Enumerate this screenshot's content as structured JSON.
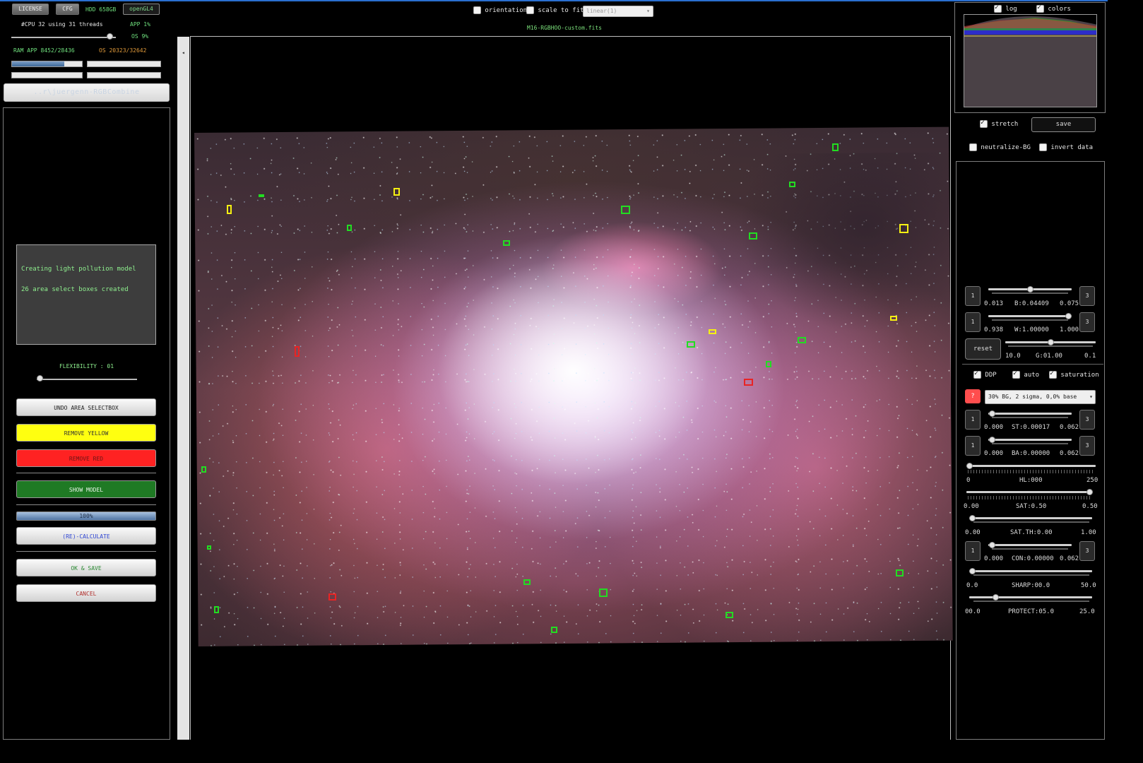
{
  "header": {
    "license": "LICENSE",
    "cfg": "CFG",
    "hdd": "HDD 658GB",
    "opengl": "openGL4",
    "cpu": "#CPU 32  using 31 threads",
    "app_cpu": "APP 1%",
    "os_cpu": "OS 9%",
    "ram": "RAM  APP 8452/28436",
    "ram_os": "OS 20323/32642",
    "ram_app_fill": 0.75,
    "path": "..r\\juergenn-RGBCombine"
  },
  "log": {
    "line1": "Creating light pollution model",
    "line2": "26 area select boxes created"
  },
  "flexibility": {
    "label": "FLEXIBILITY : 01",
    "value": 1
  },
  "buttons": {
    "undo": "UNDO AREA SELECTBOX",
    "remove_yellow": "REMOVE YELLOW",
    "remove_red": "REMOVE RED",
    "show_model": "SHOW MODEL",
    "progress": "100%",
    "calculate": "(RE)-CALCULATE",
    "ok_save": "OK & SAVE",
    "cancel": "CANCEL"
  },
  "viewer": {
    "orientation": "orientation",
    "scale_to_fit": "scale to fit",
    "scale_mode": "linear(1)",
    "filename": "M16-RGBHOO-custom.fits"
  },
  "colors": {
    "box_green": "#22dd22",
    "box_yellow": "#f5f012",
    "box_red": "#e82424",
    "accent": "#2a6fd0"
  },
  "histogram": {
    "log": "log",
    "log_checked": true,
    "colors": "colors",
    "colors_checked": true
  },
  "controls": {
    "stretch": "stretch",
    "stretch_checked": true,
    "save": "save",
    "neutralize": "neutralize-BG",
    "invert": "invert data",
    "b_min": "0.013",
    "b_label": "B:0.04409",
    "b_max": "0.075",
    "w_min": "0.938",
    "w_label": "W:1.00000",
    "w_max": "1.000",
    "reset": "reset",
    "g_min": "10.0",
    "g_label": "G:01.00",
    "g_max": "0.1",
    "ddp": "DDP",
    "auto": "auto",
    "saturation": "saturation",
    "q": "?",
    "preset": "30% BG, 2 sigma, 0,0% base",
    "st_min": "0.000",
    "st_label": "ST:0.00017",
    "st_max": "0.062",
    "ba_min": "0.000",
    "ba_label": "BA:0.00000",
    "ba_max": "0.062",
    "hl_min": "0",
    "hl_label": "HL:000",
    "hl_max": "250",
    "sat_min": "0.00",
    "sat_label": "SAT:0.50",
    "sat_max": "0.50",
    "satth_min": "0.00",
    "satth_label": "SAT.TH:0.00",
    "satth_max": "1.00",
    "con_min": "0.000",
    "con_label": "CON:0.00000",
    "con_max": "0.062",
    "sharp_min": "0.0",
    "sharp_label": "SHARP:00.0",
    "sharp_max": "50.0",
    "protect_min": "00.0",
    "protect_label": "PROTECT:05.0",
    "protect_max": "25.0",
    "sq1": "1",
    "sq3": "3"
  }
}
